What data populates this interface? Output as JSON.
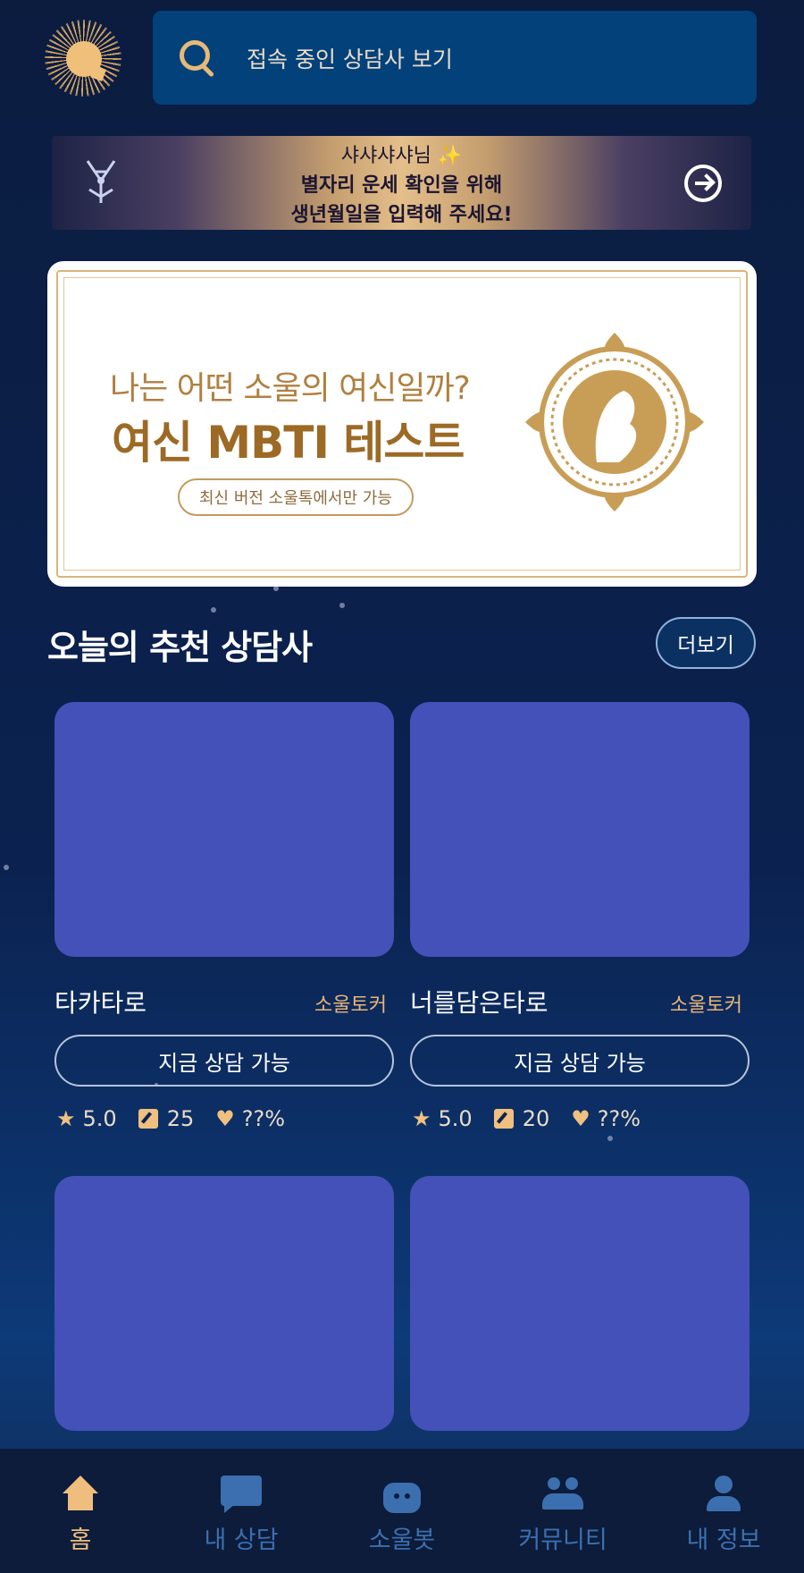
{
  "search": {
    "placeholder_text": "접속 중인 상담사 보기"
  },
  "zodiac_banner": {
    "line1": "샤샤샤샤님 ✨",
    "line2": "별자리 운세 확인을 위해",
    "line3": "생년월일을 입력해 주세요!"
  },
  "ad_banner": {
    "question": "나는 어떤 소울의 여신일까?",
    "title": "여신 MBTI 테스트",
    "pill": "최신 버전 소울톡에서만 가능"
  },
  "recommend": {
    "title": "오늘의 추천 상담사",
    "more_label": "더보기",
    "cards": [
      {
        "name": "타카타로",
        "tag": "소울토커",
        "button": "지금 상담 가능",
        "rating": "5.0",
        "reviews": "25",
        "rate": "??%"
      },
      {
        "name": "너를담은타로",
        "tag": "소울토커",
        "button": "지금 상담 가능",
        "rating": "5.0",
        "reviews": "20",
        "rate": "??%"
      }
    ]
  },
  "nav": {
    "items": [
      {
        "label": "홈",
        "icon": "home-icon",
        "active": true
      },
      {
        "label": "내 상담",
        "icon": "chat-icon",
        "active": false
      },
      {
        "label": "소울봇",
        "icon": "bot-icon",
        "active": false
      },
      {
        "label": "커뮤니티",
        "icon": "people-icon",
        "active": false
      },
      {
        "label": "내 정보",
        "icon": "user-icon",
        "active": false
      }
    ]
  },
  "colors": {
    "background": "#0b1c3f",
    "accent": "#efbe7e",
    "card_placeholder": "#4351b8",
    "nav_inactive": "#3c6fb0"
  }
}
